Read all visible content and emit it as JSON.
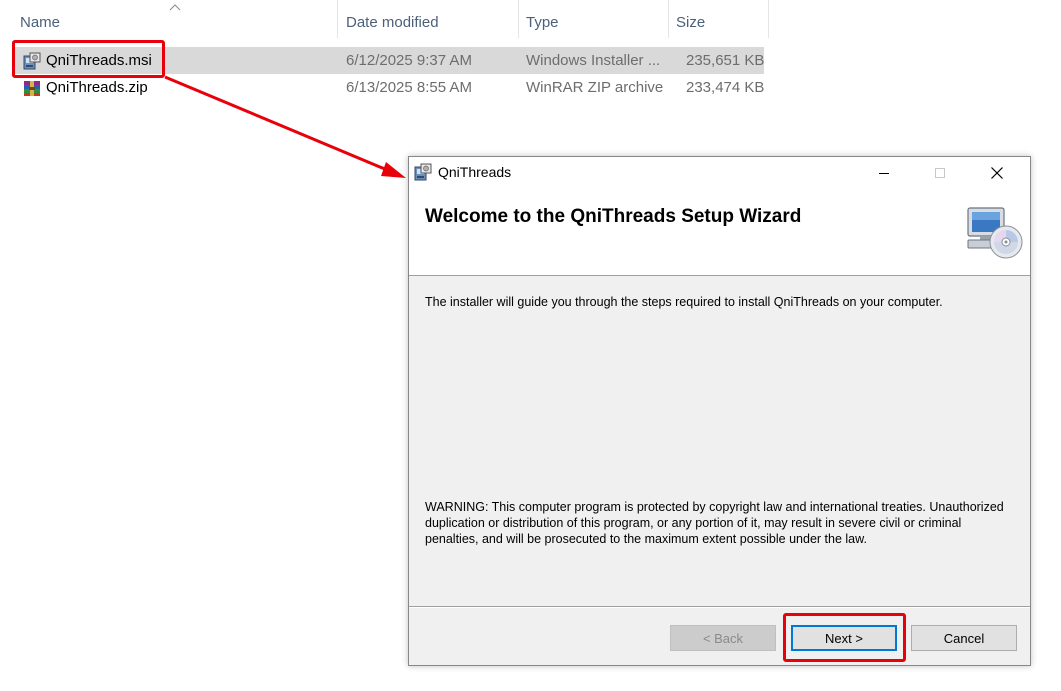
{
  "explorer": {
    "columns": {
      "name": "Name",
      "date": "Date modified",
      "type": "Type",
      "size": "Size"
    },
    "files": [
      {
        "name": "QniThreads.msi",
        "date": "6/12/2025 9:37 AM",
        "type": "Windows Installer ...",
        "size": "235,651 KB",
        "icon": "msi-installer-icon"
      },
      {
        "name": "QniThreads.zip",
        "date": "6/13/2025 8:55 AM",
        "type": "WinRAR ZIP archive",
        "size": "233,474 KB",
        "icon": "winrar-archive-icon"
      }
    ]
  },
  "dialog": {
    "title": "QniThreads",
    "heading": "Welcome to the QniThreads Setup Wizard",
    "intro": "The installer will guide you through the steps required to install QniThreads on your computer.",
    "warning": "WARNING: This computer program is protected by copyright law and international treaties. Unauthorized duplication or distribution of this program, or any portion of it, may result in severe civil or criminal penalties, and will be prosecuted to the maximum extent possible under the law.",
    "buttons": {
      "back": "< Back",
      "next": "Next >",
      "cancel": "Cancel"
    }
  },
  "annotation": {
    "color": "#e8000b"
  }
}
